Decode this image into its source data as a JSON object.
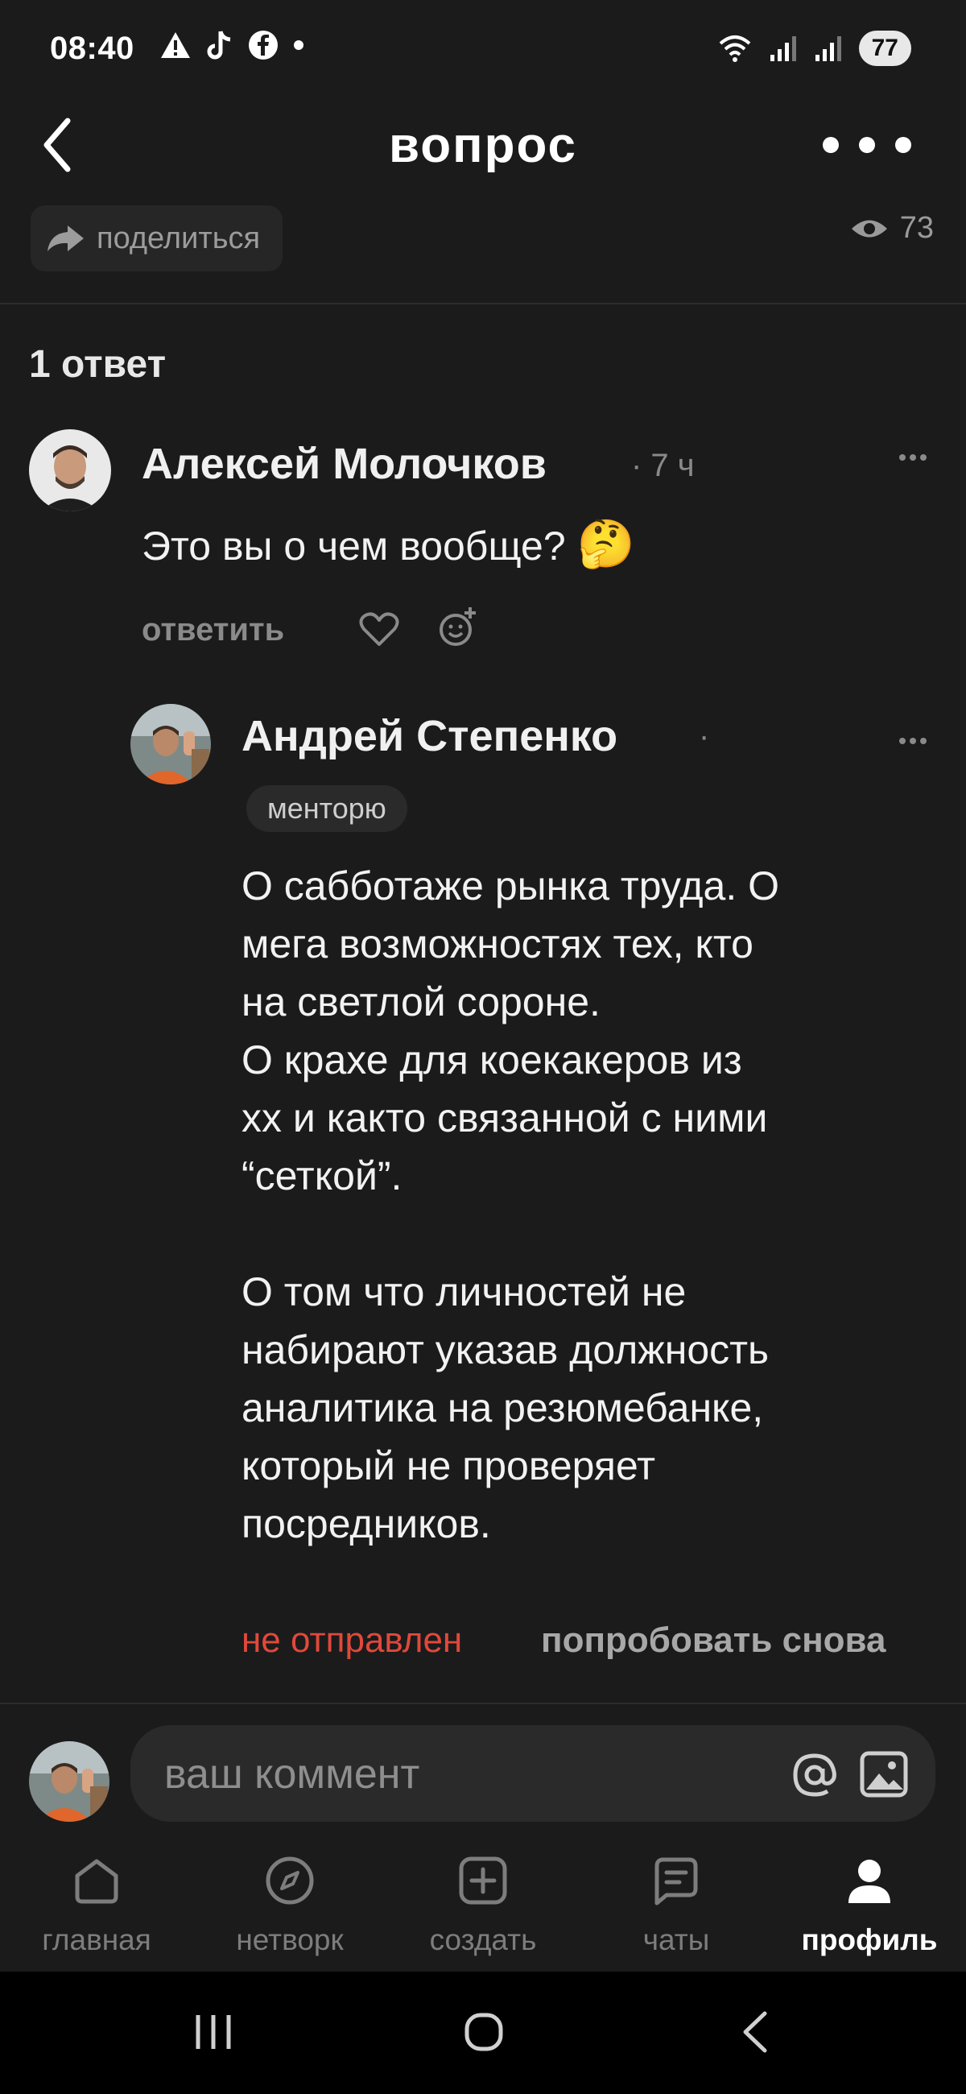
{
  "status_bar": {
    "time": "08:40",
    "battery": "77"
  },
  "header": {
    "title": "вопрос"
  },
  "actions": {
    "share_label": "поделиться",
    "views": "73"
  },
  "answers_count": "1 ответ",
  "comment": {
    "author": "Алексей Молочков",
    "time": "· 7 ч",
    "text": "Это вы о чем вообще?",
    "emoji": "🤔",
    "reply_label": "ответить"
  },
  "reply": {
    "author": "Андрей Степенко",
    "dot": "·",
    "badge": "менторю",
    "text": "О cабботаже рынка труда. О\nмега возможностях тех, кто\nна светлой сороне.\nО крахе для коекакеров из\nхх и както связанной с ними\n“сеткой”.\n\nО том что личностей не\nнабирают указав должность\nаналитика на резюмебанке,\nкоторый не проверяет\nпосредников.",
    "status": "не отправлен",
    "retry_label": "попробовать снова"
  },
  "composer": {
    "placeholder": "ваш коммент"
  },
  "nav": [
    {
      "label": "главная",
      "icon": "home-icon"
    },
    {
      "label": "нетворк",
      "icon": "compass-icon"
    },
    {
      "label": "создать",
      "icon": "plus-square-icon"
    },
    {
      "label": "чаты",
      "icon": "chat-icon"
    },
    {
      "label": "профиль",
      "icon": "profile-icon"
    }
  ],
  "colors": {
    "background": "#1b1b1c",
    "error": "#e0493b",
    "muted": "#8a8a8a"
  }
}
